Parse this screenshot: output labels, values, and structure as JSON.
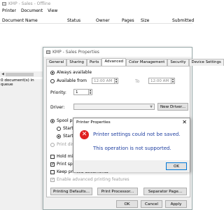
{
  "queue": {
    "title": "KMP - Sales - Offline",
    "menu": [
      "Printer",
      "Document",
      "View"
    ],
    "columns": [
      "Document Name",
      "Status",
      "Owner",
      "Pages",
      "Size",
      "Submitted"
    ],
    "status": "0 document(s) in queue"
  },
  "props": {
    "title": "KMP - Sales Properties",
    "tabs": [
      "General",
      "Sharing",
      "Ports",
      "Advanced",
      "Color Management",
      "Security",
      "Device Settings"
    ],
    "active_tab": "Advanced",
    "always_available": "Always available",
    "available_from": "Available from",
    "from_time": "12:00 AM",
    "to_label": "To",
    "to_time": "12:00 AM",
    "priority_label": "Priority:",
    "priority_value": "1",
    "driver_label": "Driver:",
    "new_driver": "New Driver...",
    "spool_print": "Spool print",
    "start_print_1": "Start pri",
    "start_print_2": "Start pri",
    "print_direct": "Print directl",
    "hold_mismatched": "Hold mism",
    "print_spooled_first": "Print spoole",
    "keep_printed": "Keep printed documents",
    "enable_advanced": "Enable advanced printing features",
    "printing_defaults": "Printing Defaults...",
    "print_processor": "Print Processor...",
    "separator_page": "Separator Page...",
    "ok": "OK",
    "cancel": "Cancel",
    "apply": "Apply"
  },
  "error": {
    "title": "Printer Properties",
    "close": "✕",
    "message1": "Printer settings could not be saved.",
    "message2": "This operation is not supported.",
    "ok": "OK",
    "icon": "error-icon"
  }
}
